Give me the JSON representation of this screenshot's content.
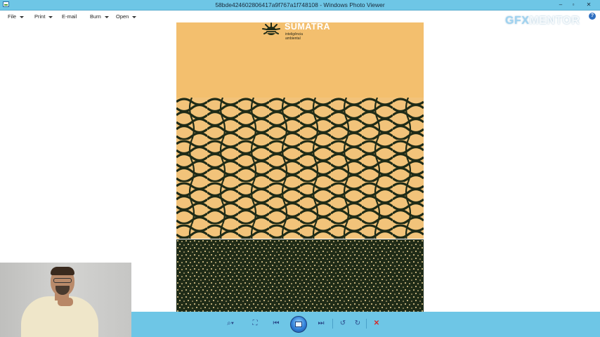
{
  "window": {
    "title": "58bde424602806417a9f767a1f748108 - Windows Photo Viewer",
    "minimize_glyph": "–",
    "maximize_glyph": "▫",
    "close_glyph": "✕"
  },
  "menu": {
    "items": [
      {
        "label": "File",
        "has_arrow": true
      },
      {
        "label": "Print",
        "has_arrow": true
      },
      {
        "label": "E-mail",
        "has_arrow": false
      },
      {
        "label": "Burn",
        "has_arrow": true
      },
      {
        "label": "Open",
        "has_arrow": true
      }
    ],
    "help_glyph": "?"
  },
  "watermark": {
    "part1": "GFX",
    "part2": "MENTOR"
  },
  "image": {
    "brand_name": "SUMATRA",
    "brand_sub_line1": "inteligência",
    "brand_sub_line2": "ambiental",
    "colors": {
      "mustard": "#f3bf6e",
      "dark_green": "#1f2b17",
      "cream": "#f2d79a"
    }
  },
  "toolbar": {
    "zoom_glyph": "⌕▾",
    "fit_glyph": "⛶",
    "prev_glyph": "⏮",
    "next_glyph": "⏭",
    "rotate_left_glyph": "↺",
    "rotate_right_glyph": "↻",
    "delete_glyph": "✕"
  }
}
